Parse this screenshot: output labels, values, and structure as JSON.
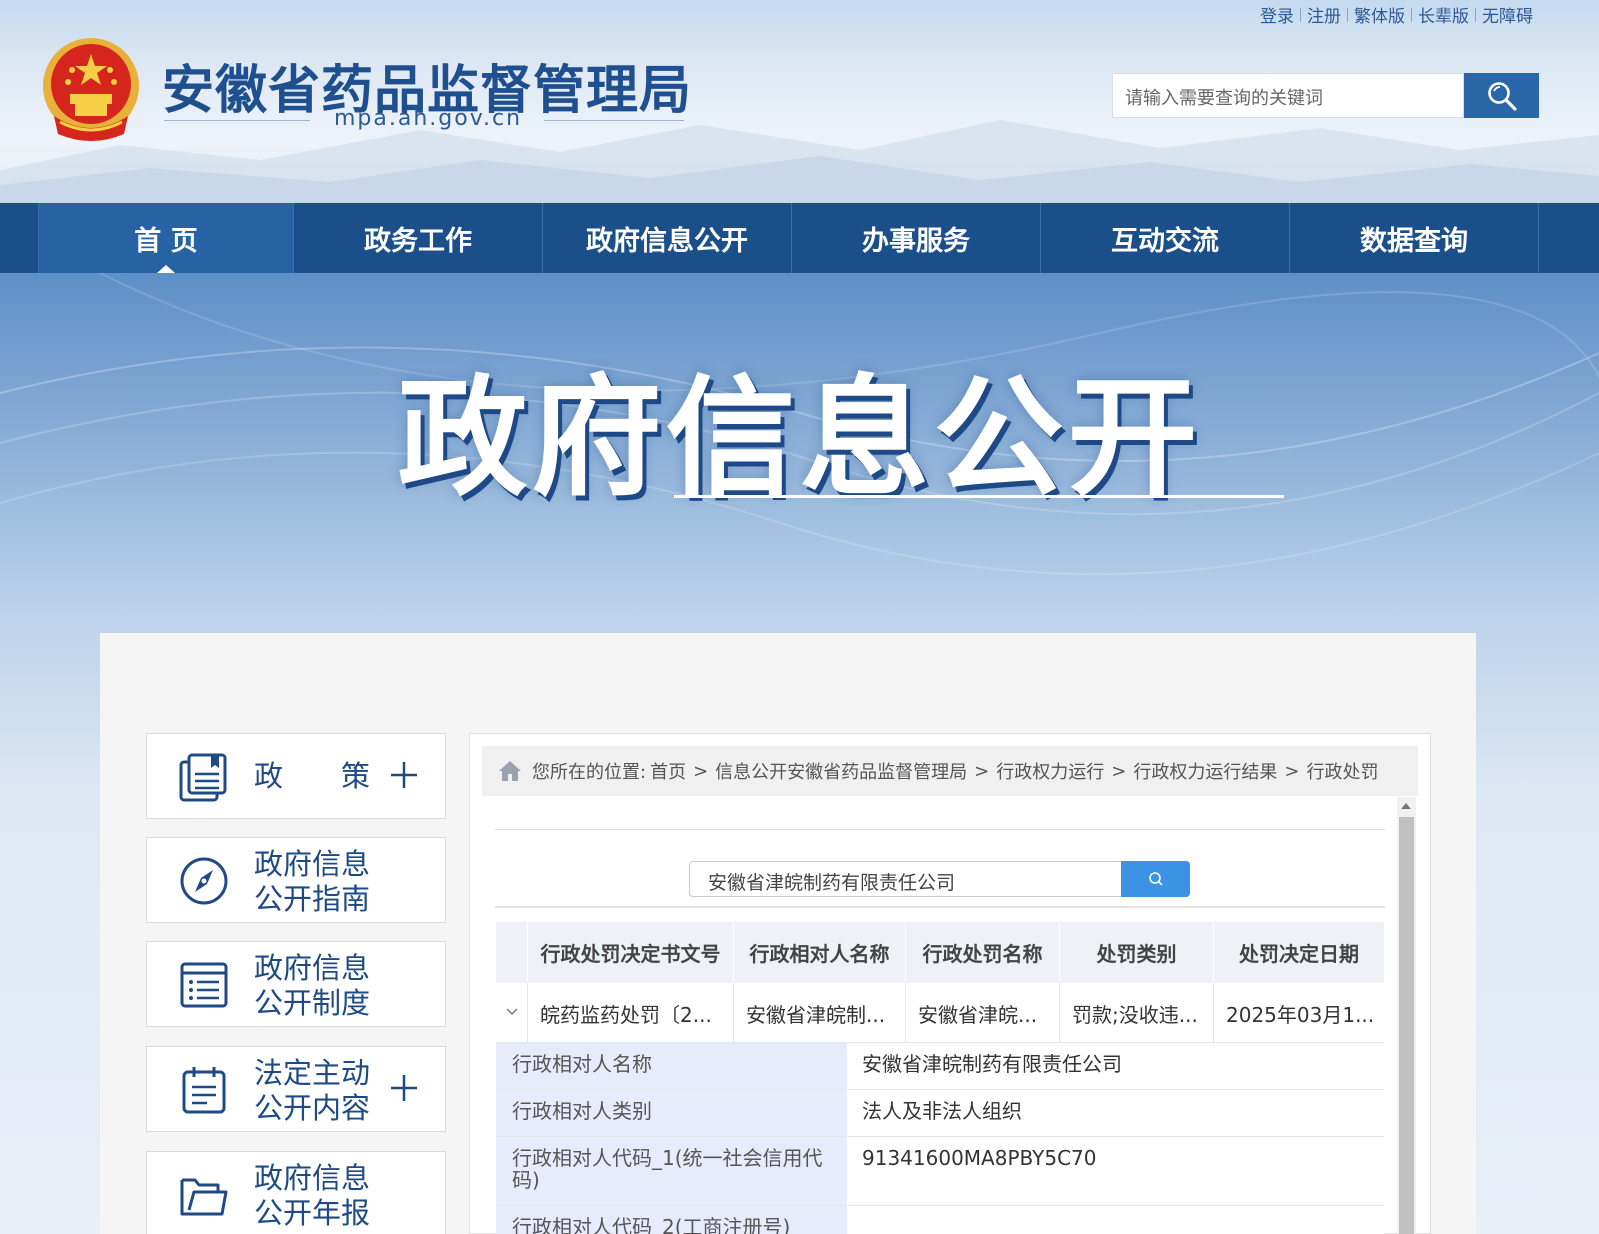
{
  "header": {
    "top_links": [
      "登录",
      "注册",
      "繁体版",
      "长辈版",
      "无障碍"
    ],
    "site_title": "安徽省药品监督管理局",
    "site_domain": "mpa.ah.gov.cn",
    "search_placeholder": "请输入需要查询的关键词"
  },
  "nav": {
    "items": [
      "首 页",
      "政务工作",
      "政府信息公开",
      "办事服务",
      "互动交流",
      "数据查询"
    ],
    "active_index": 0
  },
  "banner": {
    "title": "政府信息公开"
  },
  "sidebar": {
    "items": [
      {
        "label_line1": "政　　策",
        "label_line2": "",
        "icon": "document-icon",
        "expandable": true
      },
      {
        "label_line1": "政府信息",
        "label_line2": "公开指南",
        "icon": "compass-icon",
        "expandable": false
      },
      {
        "label_line1": "政府信息",
        "label_line2": "公开制度",
        "icon": "list-icon",
        "expandable": false
      },
      {
        "label_line1": "法定主动",
        "label_line2": "公开内容",
        "icon": "clipboard-icon",
        "expandable": true
      },
      {
        "label_line1": "政府信息",
        "label_line2": "公开年报",
        "icon": "folder-icon",
        "expandable": false
      }
    ]
  },
  "breadcrumb": {
    "prefix": "您所在的位置:",
    "items": [
      "首页",
      "信息公开安徽省药品监督管理局",
      "行政权力运行",
      "行政权力运行结果",
      "行政处罚"
    ]
  },
  "search": {
    "value": "安徽省津皖制药有限责任公司"
  },
  "table": {
    "headers": [
      "行政处罚决定书文号",
      "行政相对人名称",
      "行政处罚名称",
      "处罚类别",
      "处罚决定日期"
    ],
    "row": [
      "皖药监药处罚〔2...",
      "安徽省津皖制...",
      "安徽省津皖...",
      "罚款;没收违...",
      "2025年03月1..."
    ],
    "details": [
      {
        "key": "行政相对人名称",
        "value": "安徽省津皖制药有限责任公司"
      },
      {
        "key": "行政相对人类别",
        "value": "法人及非法人组织"
      },
      {
        "key": "行政相对人代码_1(统一社会信用代码)",
        "value": "91341600MA8PBY5C70"
      },
      {
        "key": "行政相对人代码_2(工商注册号)",
        "value": ""
      }
    ]
  },
  "colors": {
    "nav_bg": "#1b4f8a",
    "brand_blue": "#1f4f8e",
    "search_btn": "#2b67a8",
    "inner_search_btn": "#3c93e5",
    "detail_key_bg": "#e8ebfb"
  }
}
